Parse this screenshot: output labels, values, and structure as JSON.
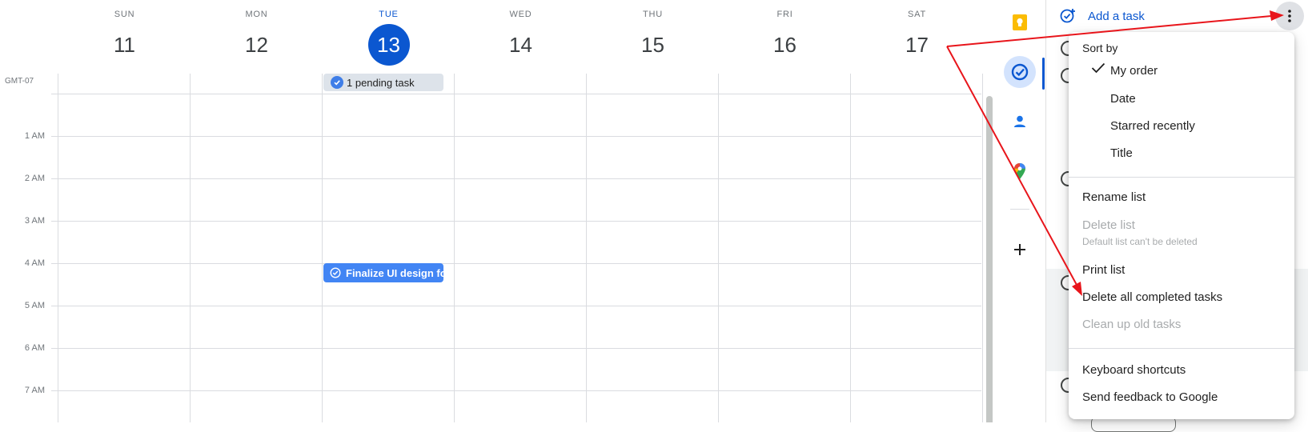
{
  "calendar": {
    "timezone": "GMT-07",
    "days": [
      {
        "name": "SUN",
        "num": "11"
      },
      {
        "name": "MON",
        "num": "12"
      },
      {
        "name": "TUE",
        "num": "13"
      },
      {
        "name": "WED",
        "num": "14"
      },
      {
        "name": "THU",
        "num": "15"
      },
      {
        "name": "FRI",
        "num": "16"
      },
      {
        "name": "SAT",
        "num": "17"
      }
    ],
    "today_index": 2,
    "hours": [
      "1 AM",
      "2 AM",
      "3 AM",
      "4 AM",
      "5 AM",
      "6 AM",
      "7 AM"
    ],
    "pending_task_chip": "1 pending task",
    "event_title": "Finalize UI design fo"
  },
  "rail": {
    "icons": [
      "keep-icon",
      "tasks-icon",
      "contacts-icon",
      "maps-icon",
      "add-icon"
    ],
    "active": "tasks-icon"
  },
  "tasks": {
    "add_task_label": "Add a task"
  },
  "menu": {
    "sort_by_label": "Sort by",
    "sort_options": [
      "My order",
      "Date",
      "Starred recently",
      "Title"
    ],
    "selected_sort": "My order",
    "rename_list": "Rename list",
    "delete_list": "Delete list",
    "delete_list_note": "Default list can't be deleted",
    "print_list": "Print list",
    "delete_completed": "Delete all completed tasks",
    "clean_up": "Clean up old tasks",
    "keyboard_shortcuts": "Keyboard shortcuts",
    "send_feedback": "Send feedback to Google"
  },
  "colors": {
    "accent": "#0b57d0",
    "event": "#4285f4",
    "annotation": "#e8151b"
  }
}
